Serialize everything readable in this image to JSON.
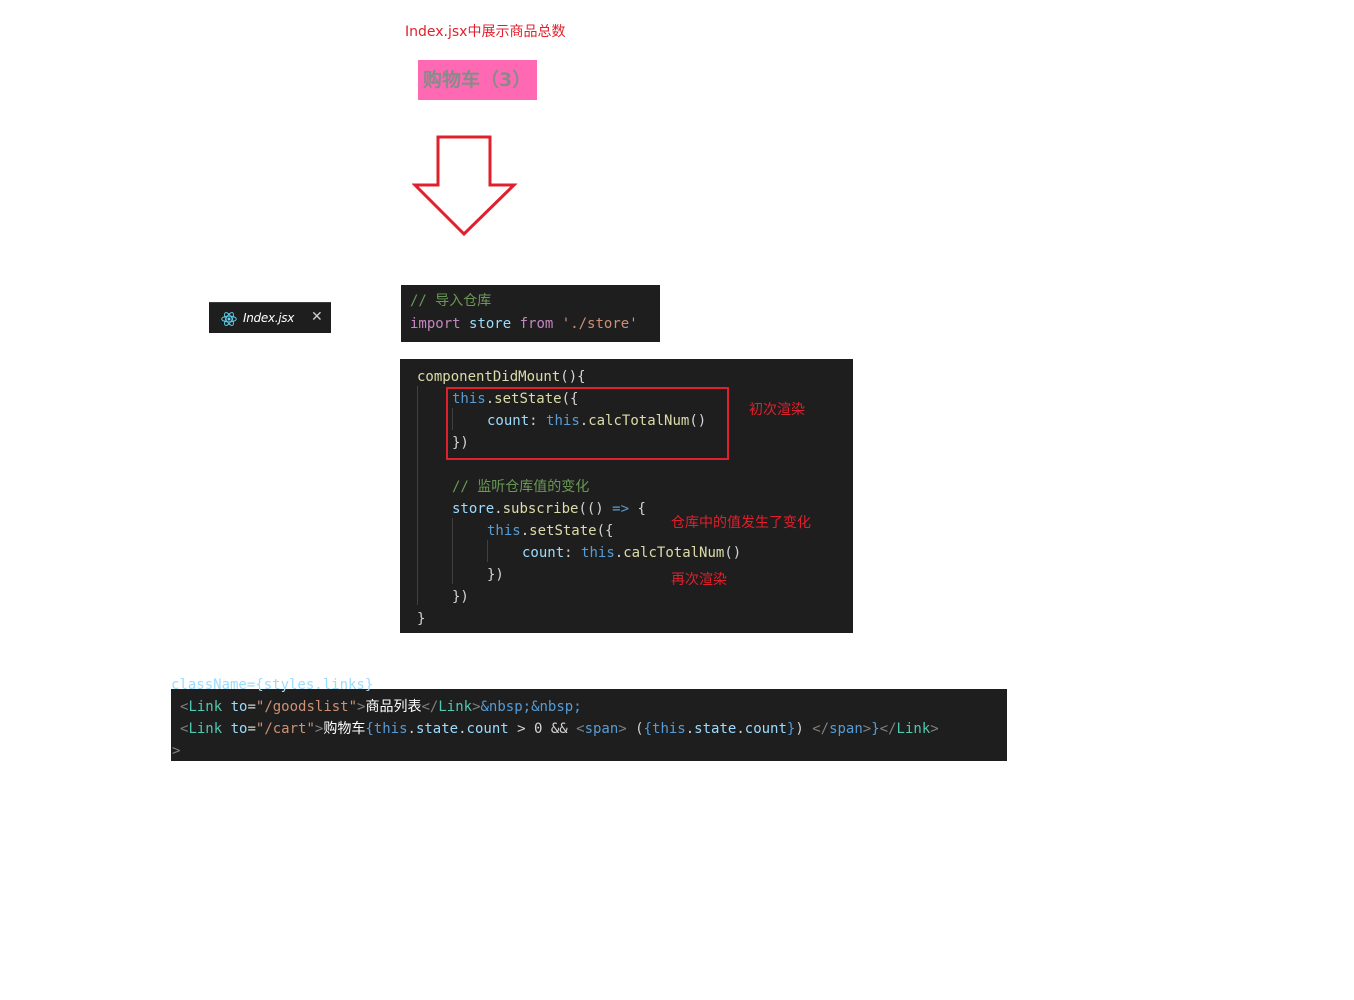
{
  "heading": "Index.jsx中展示商品总数",
  "cart_badge": "购物车（3）",
  "editor_tab": {
    "file_name": "Index.jsx",
    "icon": "react-icon",
    "close_icon": "close-icon"
  },
  "import_code": {
    "comment": "// 导入仓库",
    "keyword_import": "import",
    "identifier": "store",
    "keyword_from": "from",
    "path": "'./store'"
  },
  "mount_code": {
    "method": "componentDidMount",
    "open": "(){",
    "this": "this",
    "set_state": "setState",
    "paren_brace": "({",
    "count_key": "count",
    "colon": ":",
    "calc": "calcTotalNum",
    "call": "()",
    "close_call": "})",
    "comment": "// 监听仓库值的变化",
    "store": "store",
    "subscribe": "subscribe",
    "arrow_open": "(() ",
    "arrow": "=>",
    "brace": " {",
    "close_brace": "}",
    "dot": "."
  },
  "annotations": {
    "initial_render": "初次渲染",
    "store_changed": "仓库中的值发生了变化",
    "rerender": "再次渲染"
  },
  "jsx_code": {
    "cut_top": "className={styles.links}",
    "lt": "<",
    "gt": ">",
    "close_lt": "</",
    "link": "Link",
    "attr_to": "to",
    "eq": "=",
    "goodslist_path": "\"/goodslist\"",
    "goodslist_text": "商品列表",
    "nbsp": "&nbsp;&nbsp;",
    "cart_path": "\"/cart\"",
    "cart_text": "购物车",
    "lbrace": "{",
    "rbrace": "}",
    "this": "this",
    "state": "state",
    "count": "count",
    "dot": ".",
    "cond": " > 0 && ",
    "span": "span",
    "open_paren": " (",
    "close_paren": ") ",
    "last_gt": ">"
  }
}
